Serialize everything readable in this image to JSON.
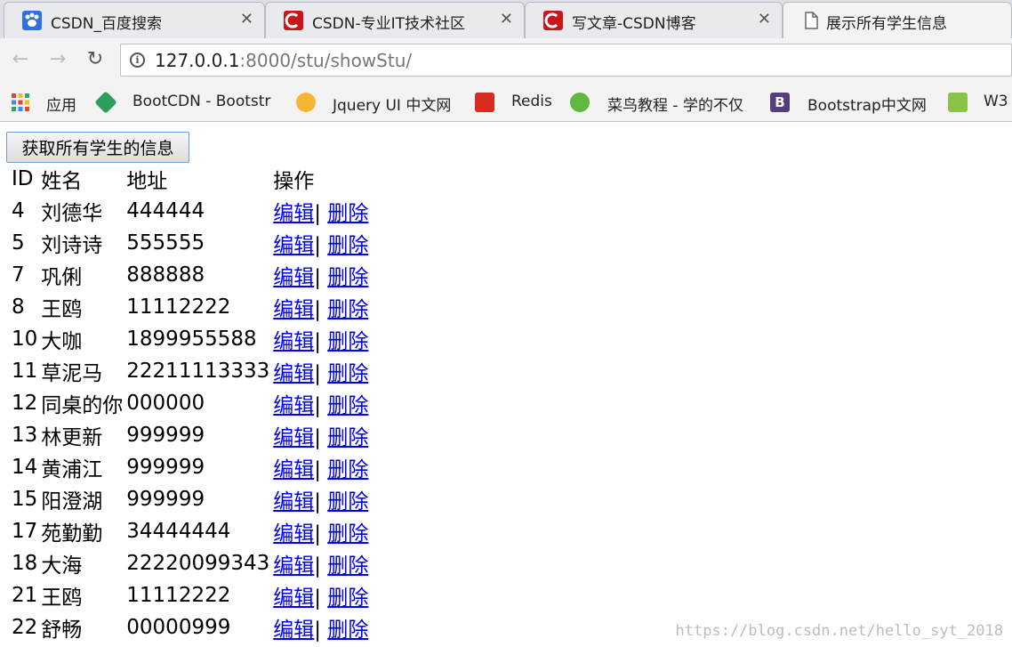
{
  "tabs": [
    {
      "title": "CSDN_百度搜索",
      "icon": "baidu-paw-icon",
      "color": "#2f6fe0"
    },
    {
      "title": "CSDN-专业IT技术社区",
      "icon": "csdn-logo-icon",
      "color": "#c9161b"
    },
    {
      "title": "写文章-CSDN博客",
      "icon": "csdn-logo-icon",
      "color": "#c9161b"
    },
    {
      "title": "展示所有学生信息",
      "icon": "document-icon",
      "color": "#666666"
    }
  ],
  "address": {
    "host": "127.0.0.1",
    "rest": ":8000/stu/showStu/"
  },
  "bookmarks": [
    {
      "label": "应用",
      "icon": "apps-grid-icon"
    },
    {
      "label": "BootCDN - Bootstr",
      "icon": "bootcdn-icon",
      "color": "#2c9f5b"
    },
    {
      "label": "Jquery UI 中文网",
      "icon": "jqueryui-icon",
      "color": "#f5b733"
    },
    {
      "label": "Redis",
      "icon": "redis-icon",
      "color": "#d82c20"
    },
    {
      "label": "菜鸟教程 - 学的不仅",
      "icon": "runoob-icon",
      "color": "#5fb840"
    },
    {
      "label": "Bootstrap中文网",
      "icon": "bootstrap-icon",
      "color": "#563d7c"
    },
    {
      "label": "W3",
      "icon": "w3school-icon",
      "color": "#8bc34a"
    }
  ],
  "fetch_button": "获取所有学生的信息",
  "table": {
    "headers": [
      "ID",
      "姓名",
      "地址",
      "操作"
    ],
    "edit_label": "编辑",
    "separator": "|",
    "delete_label": "删除",
    "rows": [
      {
        "id": "4",
        "name": "刘德华",
        "address": "444444"
      },
      {
        "id": "5",
        "name": "刘诗诗",
        "address": "555555"
      },
      {
        "id": "7",
        "name": "巩俐",
        "address": "888888"
      },
      {
        "id": "8",
        "name": "王鸥",
        "address": "11112222"
      },
      {
        "id": "10",
        "name": "大咖",
        "address": "1899955588"
      },
      {
        "id": "11",
        "name": "草泥马",
        "address": "22211113333"
      },
      {
        "id": "12",
        "name": "同桌的你",
        "address": "000000"
      },
      {
        "id": "13",
        "name": "林更新",
        "address": "999999"
      },
      {
        "id": "14",
        "name": "黄浦江",
        "address": "999999"
      },
      {
        "id": "15",
        "name": "阳澄湖",
        "address": "999999"
      },
      {
        "id": "17",
        "name": "苑勤勤",
        "address": "34444444"
      },
      {
        "id": "18",
        "name": "大海",
        "address": "22220099343"
      },
      {
        "id": "21",
        "name": "王鸥",
        "address": "11112222"
      },
      {
        "id": "22",
        "name": "舒畅",
        "address": "00000999"
      }
    ]
  },
  "watermark": "https://blog.csdn.net/hello_syt_2018"
}
